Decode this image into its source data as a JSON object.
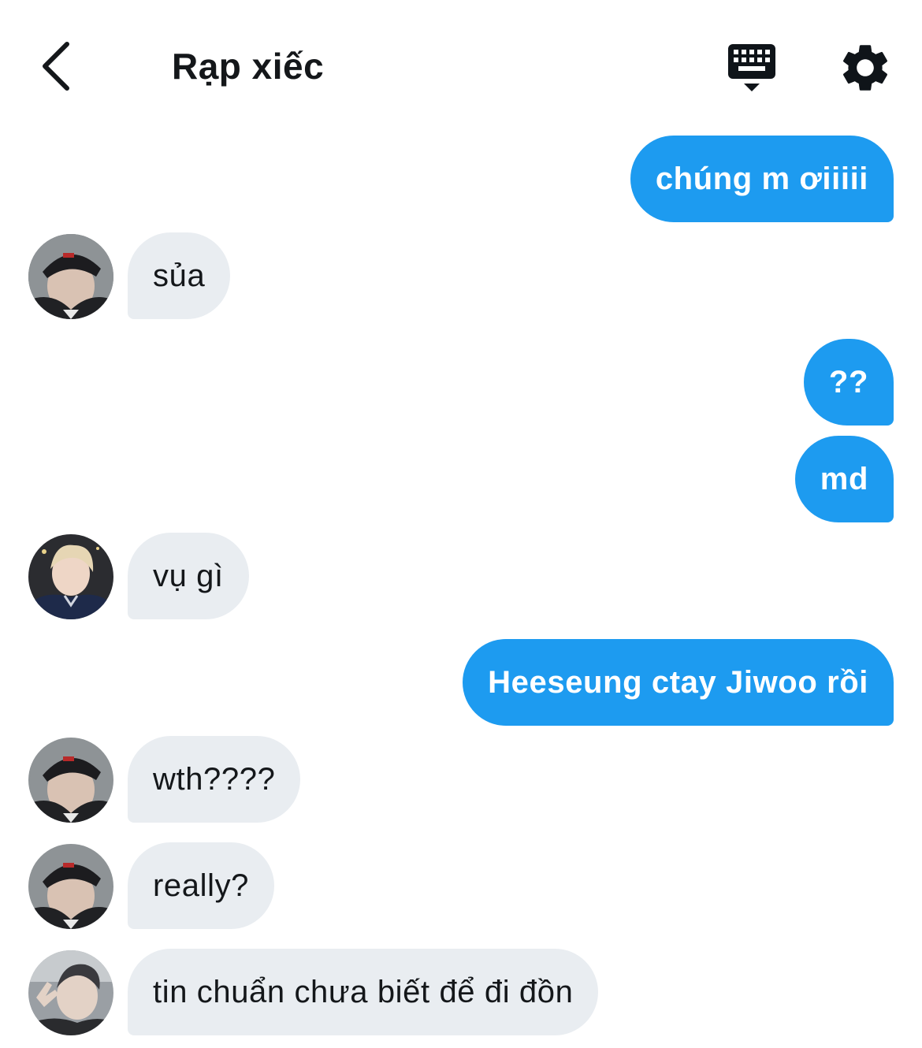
{
  "header": {
    "title": "Rạp xiếc",
    "back_icon": "chevron-left-icon",
    "keyboard_icon": "keyboard-icon",
    "settings_icon": "gear-icon"
  },
  "colors": {
    "outgoing_bubble": "#1d9bf0",
    "incoming_bubble": "#e9edf1",
    "text": "#14171a"
  },
  "messages": [
    {
      "direction": "out",
      "text": "chúng m ơiiiii"
    },
    {
      "direction": "in",
      "text": "sủa",
      "avatar": "avatar-user-cap"
    },
    {
      "direction": "out",
      "text": "??"
    },
    {
      "direction": "out",
      "text": "md"
    },
    {
      "direction": "in",
      "text": "vụ gì",
      "avatar": "avatar-user-blond"
    },
    {
      "direction": "out",
      "text": "Heeseung ctay Jiwoo rồi"
    },
    {
      "direction": "in",
      "text": "wth????",
      "avatar": "avatar-user-cap"
    },
    {
      "direction": "in",
      "text": "really?",
      "avatar": "avatar-user-cap"
    },
    {
      "direction": "in",
      "text": "tin chuẩn chưa biết để đi đồn",
      "avatar": "avatar-user-peace"
    }
  ]
}
